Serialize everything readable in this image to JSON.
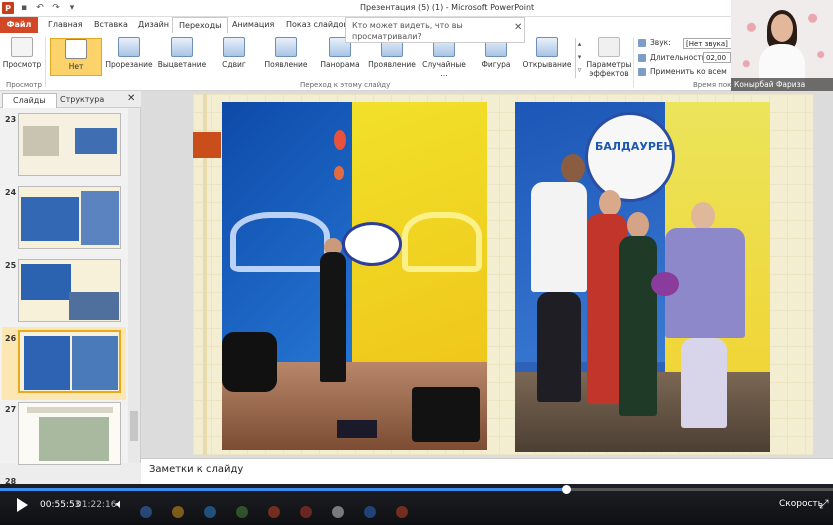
{
  "window": {
    "title": "Презентация (5) (1)  -  Microsoft PowerPoint"
  },
  "tabs": [
    {
      "label": "Файл"
    },
    {
      "label": "Главная"
    },
    {
      "label": "Вставка"
    },
    {
      "label": "Дизайн"
    },
    {
      "label": "Переходы"
    },
    {
      "label": "Анимация"
    },
    {
      "label": "Показ слайдов"
    }
  ],
  "tellme": {
    "text": "Кто может видеть, что вы просматривали?"
  },
  "ribbon": {
    "preview_label": "Просмотр",
    "preview_group": "Просмотр",
    "transitions": [
      {
        "label": "Нет"
      },
      {
        "label": "Прорезание"
      },
      {
        "label": "Выцветание"
      },
      {
        "label": "Сдвиг"
      },
      {
        "label": "Появление"
      },
      {
        "label": "Панорама"
      },
      {
        "label": "Проявление"
      },
      {
        "label": "Случайные ..."
      },
      {
        "label": "Фигура"
      },
      {
        "label": "Открывание"
      }
    ],
    "effect_params_label": "Параметры эффектов",
    "transition_group": "Переход к этому слайду",
    "sound_label": "Звук:",
    "sound_value": "[Нет звука]",
    "duration_label": "Длительность:",
    "duration_value": "02,00",
    "apply_all_label": "Применить ко всем",
    "timing_group": "Время показа слайдов"
  },
  "webcam": {
    "name": "Конырбай Фариза"
  },
  "left_pane": {
    "tabs": [
      {
        "label": "Слайды"
      },
      {
        "label": "Структура"
      }
    ],
    "slide_numbers": [
      "23",
      "24",
      "25",
      "26",
      "27",
      "28"
    ],
    "selected_slide": "26"
  },
  "slide": {
    "logo_text": "БАЛДАУРЕН"
  },
  "notes": {
    "placeholder": "Заметки к слайду"
  },
  "player": {
    "current_time": "00:55:53",
    "total_time": "01:22:16",
    "progress": 0.679,
    "speed_label": "Скорость"
  }
}
